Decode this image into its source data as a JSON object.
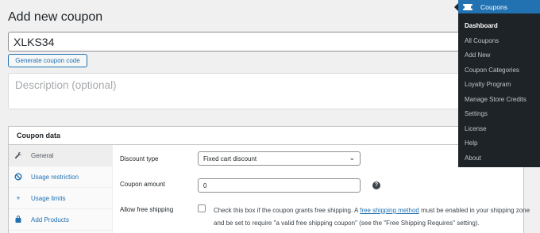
{
  "page": {
    "title": "Add new coupon"
  },
  "coupon": {
    "code_value": "XLKS34",
    "generate_label": "Generate coupon code",
    "description_placeholder": "Description (optional)"
  },
  "coupon_data": {
    "header": "Coupon data",
    "tabs": [
      {
        "label": "General",
        "icon": "wrench-icon",
        "active": true
      },
      {
        "label": "Usage restriction",
        "icon": "ban-icon"
      },
      {
        "label": "Usage limits",
        "icon": "plus-icon"
      },
      {
        "label": "Add Products",
        "icon": "bag-icon"
      }
    ],
    "general": {
      "discount_type_label": "Discount type",
      "discount_type_value": "Fixed cart discount",
      "coupon_amount_label": "Coupon amount",
      "coupon_amount_value": "0",
      "free_shipping_label": "Allow free shipping",
      "free_shipping_text_before": "Check this box if the coupon grants free shipping. A ",
      "free_shipping_link": "free shipping method",
      "free_shipping_text_after": " must be enabled in your shipping zone and be set to require \"a valid free shipping coupon\" (see the \"Free Shipping Requires\" setting)."
    }
  },
  "admin_menu": {
    "title": "Coupons",
    "items": [
      {
        "label": "Dashboard",
        "current": true
      },
      {
        "label": "All Coupons"
      },
      {
        "label": "Add New"
      },
      {
        "label": "Coupon Categories"
      },
      {
        "label": "Loyalty Program"
      },
      {
        "label": "Manage Store Credits"
      },
      {
        "label": "Settings"
      },
      {
        "label": "License"
      },
      {
        "label": "Help"
      },
      {
        "label": "About"
      }
    ]
  }
}
